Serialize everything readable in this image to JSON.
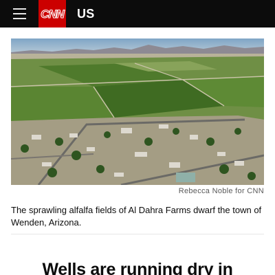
{
  "header": {
    "menu_icon": "hamburger-menu-icon",
    "logo_text": "CNN",
    "edition_label": "US",
    "colors": {
      "bar": "#0c0c0c",
      "logo": "#cc0000"
    }
  },
  "article": {
    "image": {
      "subject": "aerial view of alfalfa fields and a small desert town"
    },
    "photo_credit": "Rebecca Noble for CNN",
    "caption": "The sprawling alfalfa fields of Al Dahra Farms dwarf the town of Wenden, Arizona.",
    "headline": "Wells are running dry in"
  }
}
